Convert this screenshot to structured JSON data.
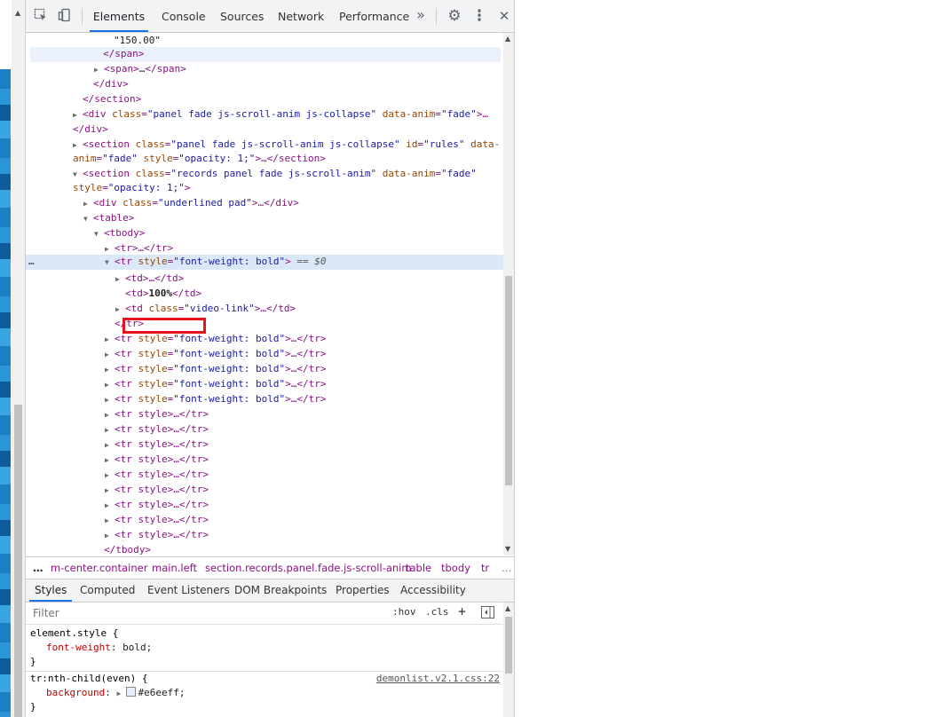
{
  "toolbar": {
    "tabs": [
      "Elements",
      "Console",
      "Sources",
      "Network",
      "Performance"
    ],
    "more": "»",
    "close": "✕",
    "kebab": "⋮",
    "gear": "⚙"
  },
  "tree": {
    "lines": {
      "l0": "\"150.00\"",
      "l1": "</span>",
      "l2a": "<span>",
      "l2b": "…",
      "l2c": "</span>",
      "l3": "</div>",
      "l4": "</section>",
      "l5_tag": "<div",
      "l5_a1": "class",
      "l5_v1": "\"panel fade js-scroll-anim js-collapse\"",
      "l5_a2": "data-anim",
      "l5_v2": "\"fade\"",
      "l5_end": ">…",
      "l6": "</div>",
      "l7_tag": "<section",
      "l7_a1": "class",
      "l7_v1": "\"panel fade js-scroll-anim js-collapse\"",
      "l7_a2": "id",
      "l7_v2": "\"rules\"",
      "l7_a3": "data-",
      "l8_a3": "anim",
      "l8_v3": "\"fade\"",
      "l8_a4": "style",
      "l8_v4": "\"opacity: 1;\"",
      "l8_end": ">…</section>",
      "l9_tag": "<section",
      "l9_a1": "class",
      "l9_v1": "\"records panel fade js-scroll-anim\"",
      "l9_a2": "data-anim",
      "l9_v2": "\"fade\"",
      "l10_a": "style",
      "l10_v": "\"opacity: 1;\"",
      "l10_end": ">",
      "l11_tag": "<div",
      "l11_a": "class",
      "l11_v": "\"underlined pad\"",
      "l11_end": ">…</div>",
      "l12": "<table>",
      "l13": "<tbody>",
      "l14": "<tr>…</tr>",
      "l15_tag": "<tr",
      "l15_a": "style",
      "l15_v": "\"font-weight: bold\"",
      "l15_end": ">",
      "l15_eq": "== $0",
      "l16": "<td>…</td>",
      "l17a": "<td>",
      "l17b": "100%",
      "l17c": "</td>",
      "l18_tag": "<td",
      "l18_a": "class",
      "l18_v": "\"video-link\"",
      "l18_end": ">…</td>",
      "l19": "</tr>",
      "bold_tr_tag": "<tr",
      "bold_tr_a": "style",
      "bold_tr_v": "\"font-weight: bold\"",
      "bold_tr_end": ">…</tr>",
      "style_tr": "<tr style>…</tr>",
      "l_end": "</tbody>"
    },
    "dots": "…"
  },
  "breadcrumbs": {
    "ellipsis_left": "…",
    "items": [
      "m-center.container",
      "main.left",
      "section.records.panel.fade.js-scroll-anim",
      "table",
      "tbody",
      "tr"
    ],
    "ellipsis_right": "…"
  },
  "styles_tabs": [
    "Styles",
    "Computed",
    "Event Listeners",
    "DOM Breakpoints",
    "Properties",
    "Accessibility"
  ],
  "filter": {
    "placeholder": "Filter",
    "hov": ":hov",
    "cls": ".cls",
    "plus": "+"
  },
  "rules": {
    "r1_selector": "element.style {",
    "r1_prop": "font-weight",
    "r1_val": "bold;",
    "r1_close": "}",
    "r2_selector": "tr:nth-child(even) {",
    "r2_source": "demonlist.v2.1.css:22",
    "r2_prop": "background",
    "r2_val": "#e6eeff;",
    "r2_close": "}",
    "swatch_color": "#e6eeff"
  }
}
